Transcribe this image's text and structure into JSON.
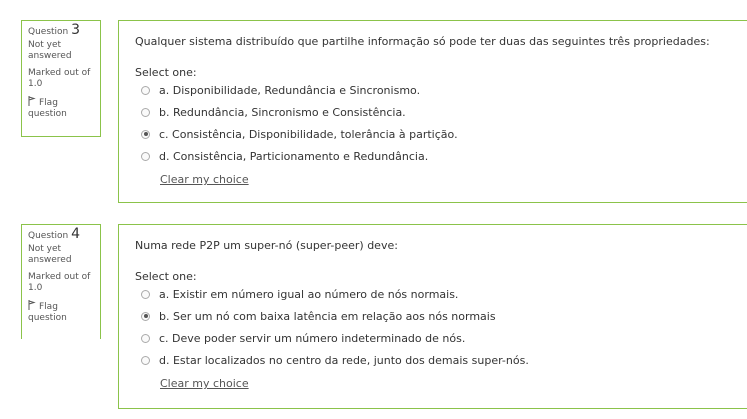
{
  "questions": [
    {
      "info": {
        "label": "Question",
        "number": "3",
        "state": "Not yet answered",
        "grade": "Marked out of 1.0",
        "flag": "Flag question"
      },
      "text": "Qualquer sistema distribuído que partilhe informação só pode ter duas das seguintes três propriedades:",
      "prompt": "Select one:",
      "options": [
        {
          "label": "a. Disponibilidade, Redundância e Sincronismo.",
          "selected": false
        },
        {
          "label": "b. Redundância, Sincronismo e Consistência.",
          "selected": false
        },
        {
          "label": "c. Consistência, Disponibilidade, tolerância à partição.",
          "selected": true
        },
        {
          "label": "d. Consistência, Particionamento e Redundância.",
          "selected": false
        }
      ],
      "clear": "Clear my choice"
    },
    {
      "info": {
        "label": "Question",
        "number": "4",
        "state": "Not yet answered",
        "grade": "Marked out of 1.0",
        "flag": "Flag question"
      },
      "text": "Numa rede P2P um super-nó (super-peer) deve:",
      "prompt": "Select one:",
      "options": [
        {
          "label": "a. Existir em número igual ao número de nós normais.",
          "selected": false
        },
        {
          "label": "b. Ser um nó com baixa latência em relação aos nós normais",
          "selected": true
        },
        {
          "label": "c. Deve poder servir um número indeterminado de nós.",
          "selected": false
        },
        {
          "label": "d. Estar localizados no centro da rede, junto dos demais super-nós.",
          "selected": false
        }
      ],
      "clear": "Clear my choice"
    }
  ]
}
